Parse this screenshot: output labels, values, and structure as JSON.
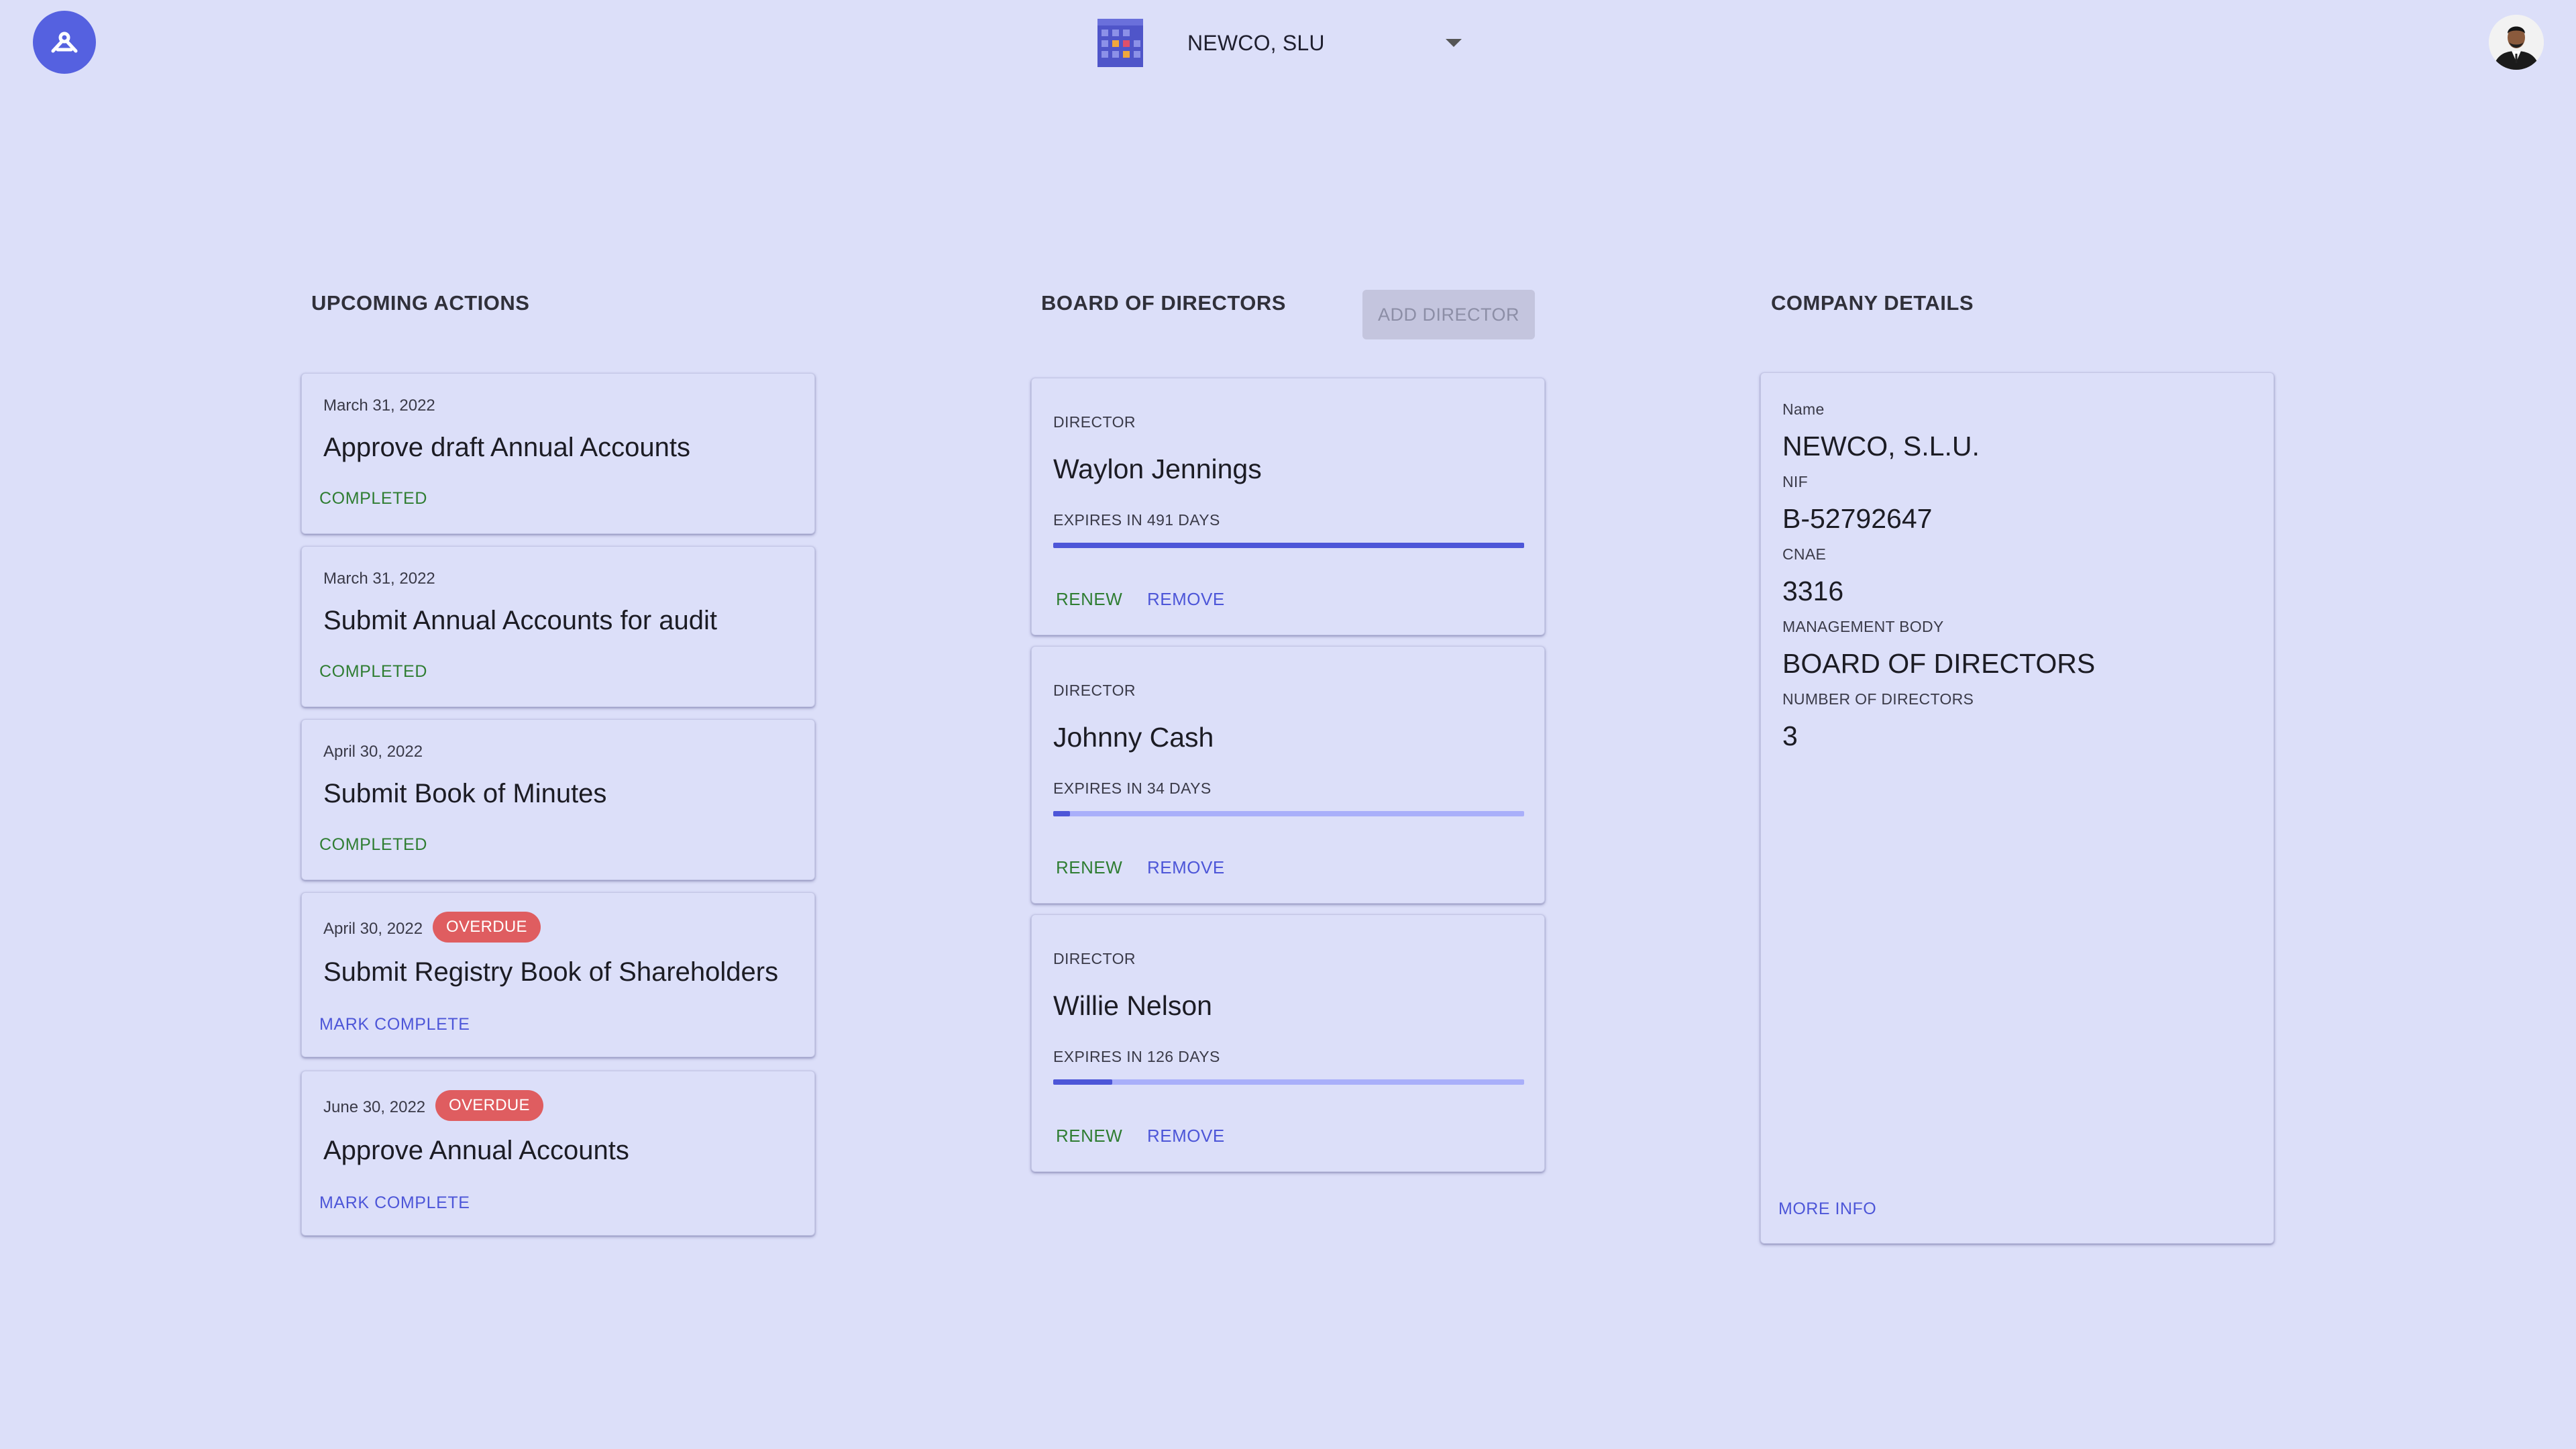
{
  "header": {
    "logo_icon": "app-logo-icon",
    "company_icon": "building-icon",
    "company_name": "NEWCO, SLU",
    "dropdown_icon": "caret-down-icon",
    "avatar_icon": "user-avatar"
  },
  "upcoming": {
    "title": "UPCOMING ACTIONS",
    "items": [
      {
        "date": "March 31, 2022",
        "title": "Approve draft Annual Accounts",
        "status": "COMPLETED"
      },
      {
        "date": "March 31, 2022",
        "title": "Submit Annual Accounts for audit",
        "status": "COMPLETED"
      },
      {
        "date": "April 30, 2022",
        "title": "Submit Book of Minutes",
        "status": "COMPLETED"
      },
      {
        "date": "April 30, 2022",
        "badge": "OVERDUE",
        "title": "Submit Registry Book of Shareholders",
        "action": "MARK COMPLETE"
      },
      {
        "date": "June 30, 2022",
        "badge": "OVERDUE",
        "title": "Approve Annual Accounts",
        "action": "MARK COMPLETE"
      }
    ]
  },
  "board": {
    "title": "BOARD OF DIRECTORS",
    "add_label": "ADD DIRECTOR",
    "directors": [
      {
        "role": "DIRECTOR",
        "name": "Waylon Jennings",
        "expires": "EXPIRES IN 491 DAYS",
        "progress": 1.0,
        "renew": "RENEW",
        "remove": "REMOVE"
      },
      {
        "role": "DIRECTOR",
        "name": "Johnny Cash",
        "expires": "EXPIRES IN 34 DAYS",
        "progress": 0.035,
        "renew": "RENEW",
        "remove": "REMOVE"
      },
      {
        "role": "DIRECTOR",
        "name": "Willie Nelson",
        "expires": "EXPIRES IN 126 DAYS",
        "progress": 0.125,
        "renew": "RENEW",
        "remove": "REMOVE"
      }
    ]
  },
  "company": {
    "title": "COMPANY DETAILS",
    "fields": [
      {
        "label": "Name",
        "value": "NEWCO, S.L.U."
      },
      {
        "label": "NIF",
        "value": "B-52792647"
      },
      {
        "label": "CNAE",
        "value": "3316"
      },
      {
        "label": "MANAGEMENT BODY",
        "value": "BOARD OF DIRECTORS"
      },
      {
        "label": "NUMBER OF DIRECTORS",
        "value": "3"
      }
    ],
    "more_info": "MORE INFO"
  },
  "colors": {
    "background": "#dcdff9",
    "primary": "#4d56d8",
    "success": "#2f7d32",
    "overdue": "#df5d60"
  }
}
